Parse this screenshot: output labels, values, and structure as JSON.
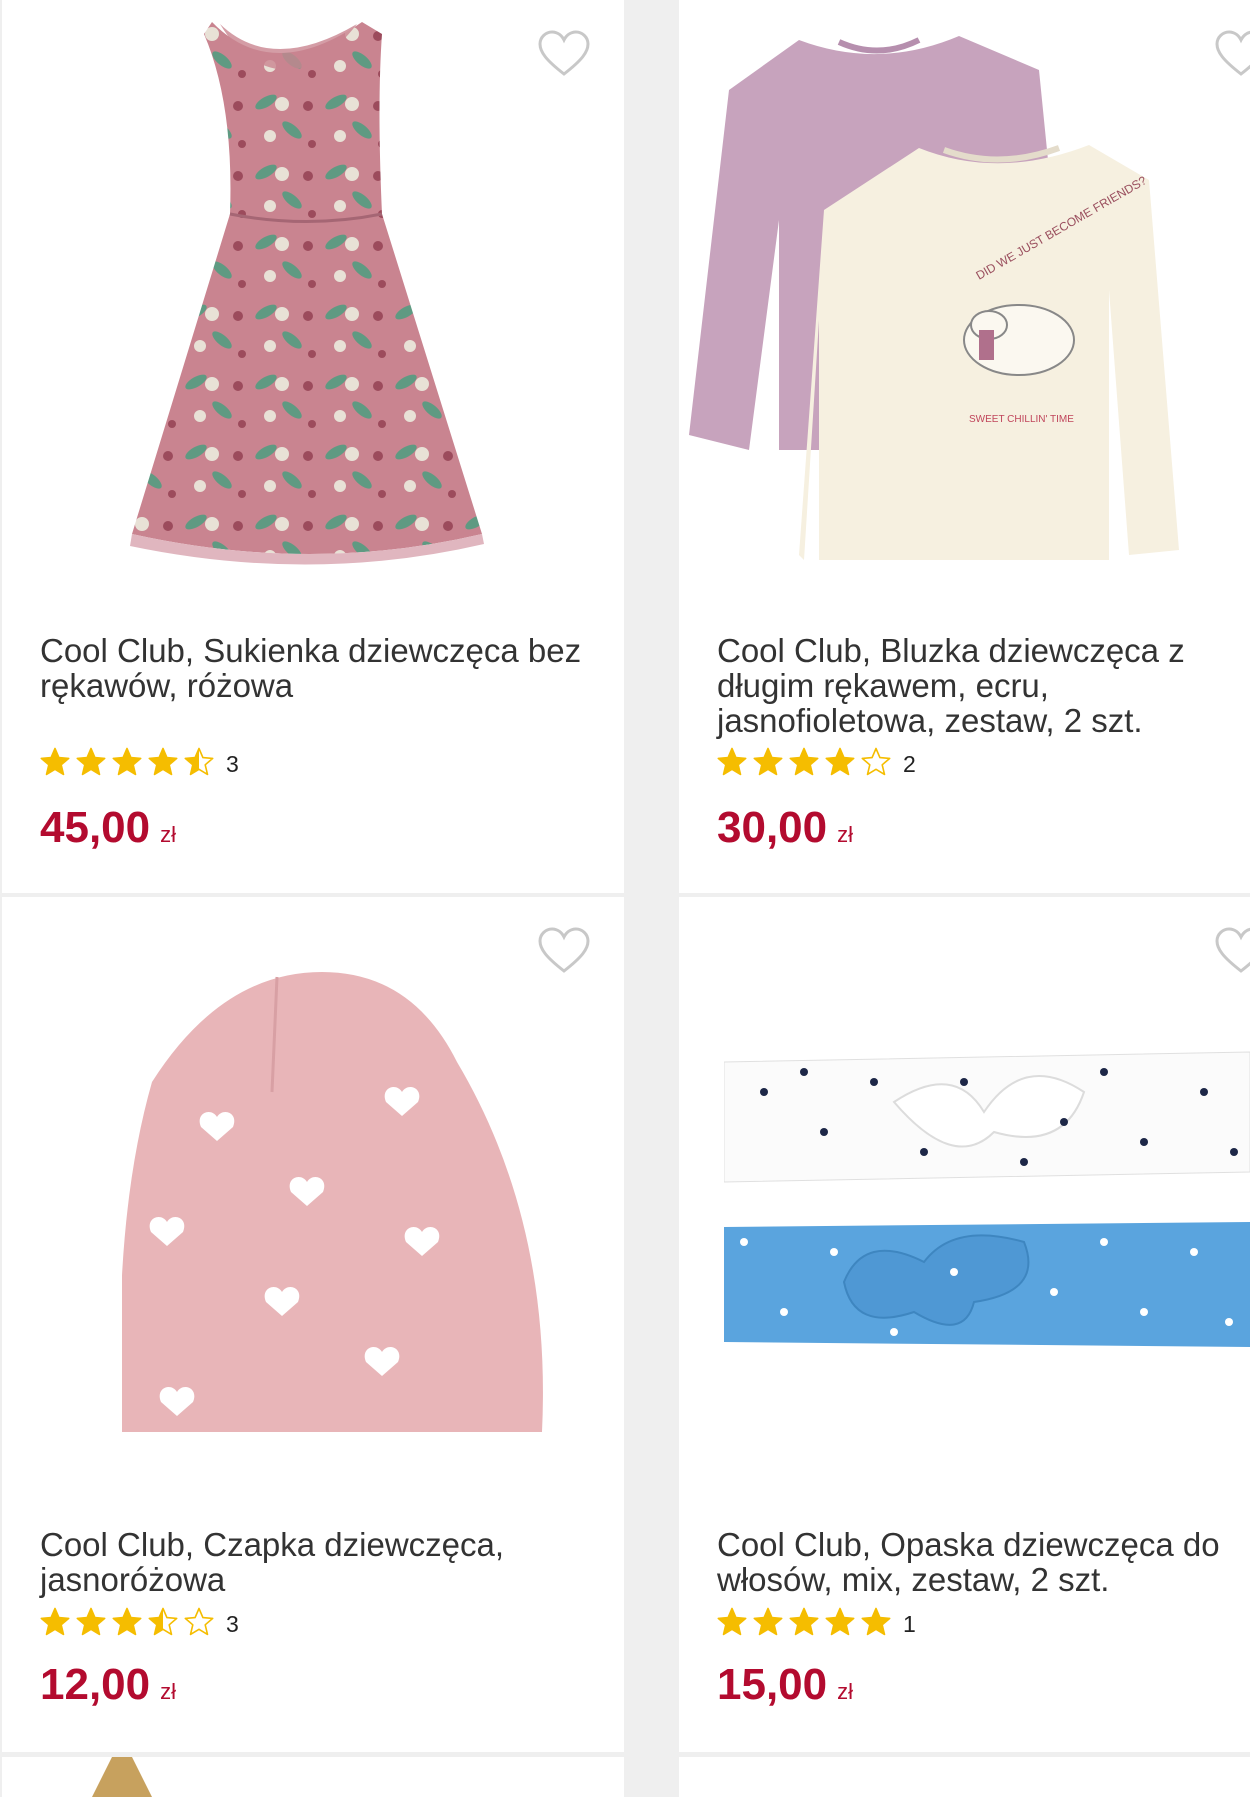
{
  "products": [
    {
      "title": "Cool Club, Sukienka dziewczęca bez rękawów, różowa",
      "rating": 4.5,
      "rating_count": "3",
      "price": "45,00",
      "currency": "zł",
      "image": "pink-floral-sleeveless-dress",
      "favorite_icon": "heart-outline-icon"
    },
    {
      "title": "Cool Club, Bluzka dziewczęca z długim rękawem, ecru, jasnofioletowa, zestaw, 2 szt.",
      "rating": 4,
      "rating_count": "2",
      "price": "30,00",
      "currency": "zł",
      "image": "two-long-sleeve-tops",
      "print_text": "DID WE JUST BECOME FRIENDS?",
      "print_subtext": "SWEET CHILLIN' TIME",
      "favorite_icon": "heart-outline-icon"
    },
    {
      "title": "Cool Club, Czapka dziewczęca, jasnoróżowa",
      "rating": 3.5,
      "rating_count": "3",
      "price": "12,00",
      "currency": "zł",
      "image": "pink-heart-beanie",
      "favorite_icon": "heart-outline-icon"
    },
    {
      "title": "Cool Club, Opaska dziewczęca do włosów, mix, zestaw, 2 szt.",
      "rating": 5,
      "rating_count": "1",
      "price": "15,00",
      "currency": "zł",
      "image": "two-bow-headbands",
      "favorite_icon": "heart-outline-icon"
    }
  ],
  "colors": {
    "price": "#b30b2f",
    "star": "#f5bd00",
    "background": "#efefef"
  }
}
